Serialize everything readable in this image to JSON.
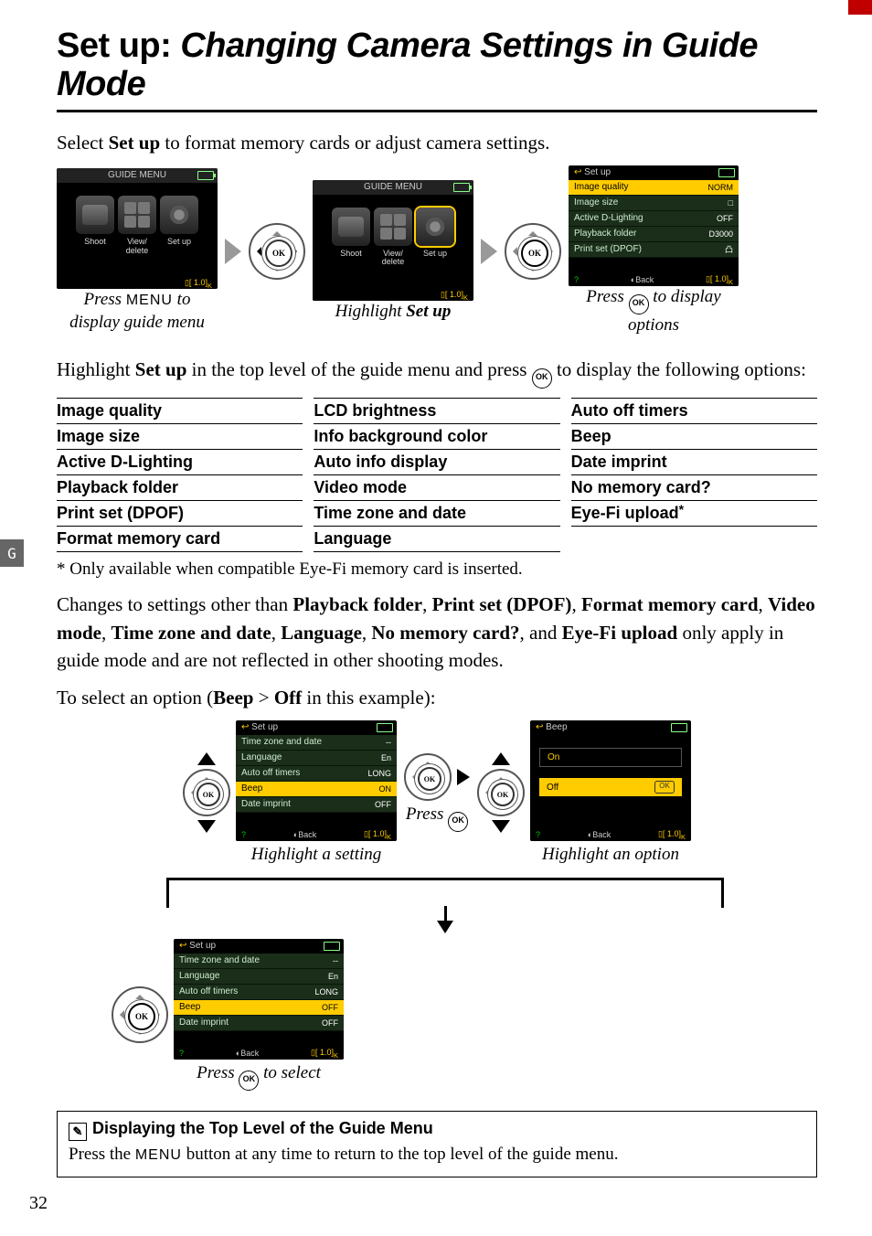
{
  "title_prefix": "Set up:",
  "title_suffix": "Changing Camera Settings in Guide Mode",
  "lead_a": "Select ",
  "lead_b_bold": "Set up",
  "lead_c": " to format memory cards or adjust camera settings.",
  "guide_menu_label": "GUIDE MENU",
  "tiles": {
    "shoot": "Shoot",
    "view": "View/\ndelete",
    "setup": "Set up"
  },
  "footer_count": "1.0",
  "cap1_a": "Press ",
  "cap1_menu": "MENU",
  "cap1_b": " to display guide menu",
  "cap2_a": "Highlight ",
  "cap2_b": "Set up",
  "cap3_a": "Press ",
  "cap3_b": " to display options",
  "setup_hdr": "Set up",
  "setup_rows": [
    {
      "l": "Image quality",
      "v": "NORM"
    },
    {
      "l": "Image size",
      "v": "□"
    },
    {
      "l": "Active D-Lighting",
      "v": "OFF"
    },
    {
      "l": "Playback folder",
      "v": "D3000"
    },
    {
      "l": "Print set (DPOF)",
      "v": "凸"
    }
  ],
  "back_lbl": "Back",
  "body2_a": "Highlight ",
  "body2_b_bold": "Set up",
  "body2_c": " in the top level of the guide menu and press ",
  "body2_d": " to display the following options:",
  "opts_col1": [
    "Image quality",
    "Image size",
    "Active D-Lighting",
    "Playback folder",
    "Print set (DPOF)",
    "Format memory card"
  ],
  "opts_col2": [
    "LCD brightness",
    "Info background color",
    "Auto info display",
    "Video mode",
    "Time zone and date",
    "Language"
  ],
  "opts_col3": [
    "Auto off timers",
    "Beep",
    "Date imprint",
    "No memory card?",
    "Eye-Fi upload"
  ],
  "eyefi_star": "*",
  "footnote": "*   Only available when compatible Eye-Fi memory card is inserted.",
  "body3_a": "Changes to settings other than ",
  "body3_bold_list": [
    "Playback folder",
    "Print set (DPOF)",
    "Format memory card",
    "Video mode",
    "Time zone and date",
    "Language",
    "No memory card?",
    "Eye-Fi upload"
  ],
  "body3_sep": ", ",
  "body3_and": ", and ",
  "body3_c": " only apply in guide mode and are not reflected in other shooting modes.",
  "body4_a": "To select an option (",
  "body4_b": "Beep",
  "body4_gt": " > ",
  "body4_c": "Off",
  "body4_d": " in this example):",
  "step1_hdr": "Set up",
  "step1_rows": [
    {
      "l": "Time zone and date",
      "v": "--"
    },
    {
      "l": "Language",
      "v": "En"
    },
    {
      "l": "Auto off timers",
      "v": "LONG"
    },
    {
      "l": "Beep",
      "v": "ON",
      "sel": true
    },
    {
      "l": "Date imprint",
      "v": "OFF"
    }
  ],
  "cap_s1": "Highlight a setting",
  "cap_s2_a": "Press ",
  "cap_s3": "Highlight an option",
  "cap_s4_a": "Press ",
  "cap_s4_b": " to select",
  "beep_hdr": "Beep",
  "beep_on": "On",
  "beep_off": "Off",
  "ok_mini": "OK",
  "step4_rows": [
    {
      "l": "Time zone and date",
      "v": "--"
    },
    {
      "l": "Language",
      "v": "En"
    },
    {
      "l": "Auto off timers",
      "v": "LONG"
    },
    {
      "l": "Beep",
      "v": "OFF",
      "sel": true
    },
    {
      "l": "Date imprint",
      "v": "OFF"
    }
  ],
  "info_title": "Displaying the Top Level of the Guide Menu",
  "info_body_a": "Press the ",
  "info_body_menu": "MENU",
  "info_body_b": " button at any time to return to the top level of the guide menu.",
  "pencil": "✎",
  "side_tab": "G",
  "page_num": "32",
  "qmark": "?"
}
